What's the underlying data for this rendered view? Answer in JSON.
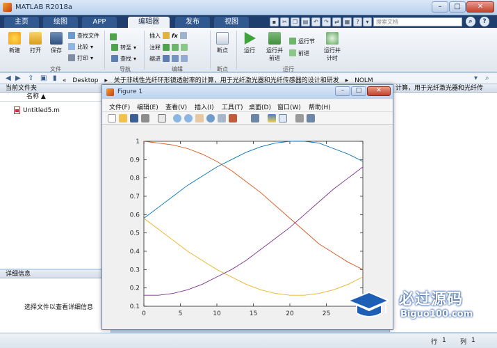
{
  "window": {
    "title": "MATLAB R2018a",
    "minimize": "–",
    "maximize": "□",
    "close": "✕"
  },
  "tabs": [
    {
      "label": "主页",
      "active": false
    },
    {
      "label": "绘图",
      "active": false
    },
    {
      "label": "APP",
      "active": false
    },
    {
      "label": "编辑器",
      "active": true
    },
    {
      "label": "发布",
      "active": false
    },
    {
      "label": "视图",
      "active": false
    }
  ],
  "quick_access": [
    "save-icon",
    "cut-icon",
    "copy-icon",
    "paste-icon",
    "undo-icon",
    "redo-icon",
    "switch-icon",
    "help-icon"
  ],
  "search": {
    "placeholder": "搜索文档"
  },
  "ribbon": {
    "file": {
      "new": "新建",
      "open": "打开",
      "save": "保存",
      "find_files": "查找文件",
      "compare": "比较",
      "print": "打印",
      "group": "文件"
    },
    "navigate": {
      "goto": "转至",
      "find": "查找",
      "group": "导航"
    },
    "edit": {
      "insert": "插入",
      "comment": "注释",
      "indent": "缩进",
      "fx": "fx",
      "group": "编辑"
    },
    "breakpoints": {
      "label": "断点",
      "group": "断点"
    },
    "run": {
      "run": "运行",
      "run_advance_1": "运行并",
      "run_advance_2": "前进",
      "run_section": "运行节",
      "advance": "前进",
      "run_time_1": "运行并",
      "run_time_2": "计时",
      "group": "运行"
    }
  },
  "address": {
    "segments": [
      "«",
      "Desktop",
      "▸",
      "关于非线性光纤环形镜透射率的计算，用于光纤激光器和光纤传感器的设计和研发",
      "▸",
      "NOLM"
    ],
    "overflow_text": "计算，用于光纤激光器和光纤传"
  },
  "current_folder": {
    "title": "当前文件夹",
    "column": "名称 ▲",
    "files": [
      "Untitled5.m"
    ]
  },
  "details": {
    "title": "详细信息",
    "empty_text": "选择文件以查看详细信息"
  },
  "status": {
    "row_label": "行",
    "row_value": "1",
    "col_label": "列",
    "col_value": "1"
  },
  "figure": {
    "title": "Figure 1",
    "menu": [
      "文件(F)",
      "编辑(E)",
      "查看(V)",
      "插入(I)",
      "工具(T)",
      "桌面(D)",
      "窗口(W)",
      "帮助(H)"
    ],
    "toolbar": [
      "new-figure-icon",
      "open-icon",
      "save-icon",
      "print-icon",
      "pointer-icon",
      "zoom-in-icon",
      "zoom-out-icon",
      "pan-icon",
      "rotate-icon",
      "data-cursor-icon",
      "brush-icon",
      "link-icon",
      "colorbar-icon",
      "legend-icon",
      "hide-tools-icon",
      "dock-icon"
    ]
  },
  "watermark": {
    "cn": "必过源码",
    "en": "Biguo100.com"
  },
  "chart_data": {
    "type": "line",
    "title": "",
    "xlabel": "",
    "ylabel": "",
    "xlim": [
      0,
      30
    ],
    "ylim": [
      0.1,
      1.0
    ],
    "xticks": [
      0,
      5,
      10,
      15,
      20,
      25,
      30
    ],
    "yticks": [
      0.1,
      0.2,
      0.3,
      0.4,
      0.5,
      0.6,
      0.7,
      0.8,
      0.9,
      1.0
    ],
    "tick_labels_x": [
      "0",
      "5",
      "10",
      "15",
      "20",
      "25",
      "30"
    ],
    "tick_labels_y": [
      "0.1",
      "0.2",
      "0.3",
      "0.4",
      "0.5",
      "0.6",
      "0.7",
      "0.8",
      "0.9",
      "1"
    ],
    "grid": false,
    "x": [
      0,
      2,
      4,
      6,
      8,
      10,
      12,
      14,
      16,
      18,
      20,
      22,
      24,
      26,
      28,
      30
    ],
    "series": [
      {
        "color": "#0072BD",
        "values": [
          0.58,
          0.64,
          0.7,
          0.76,
          0.81,
          0.86,
          0.9,
          0.94,
          0.97,
          0.99,
          1.0,
          1.0,
          0.99,
          0.96,
          0.93,
          0.89
        ]
      },
      {
        "color": "#D95319",
        "values": [
          1.0,
          0.99,
          0.98,
          0.96,
          0.93,
          0.89,
          0.84,
          0.78,
          0.72,
          0.65,
          0.58,
          0.51,
          0.44,
          0.39,
          0.34,
          0.3
        ]
      },
      {
        "color": "#EDB120",
        "values": [
          0.58,
          0.52,
          0.46,
          0.4,
          0.35,
          0.3,
          0.26,
          0.22,
          0.19,
          0.17,
          0.16,
          0.16,
          0.17,
          0.19,
          0.22,
          0.26
        ]
      },
      {
        "color": "#7E2F8E",
        "values": [
          0.16,
          0.16,
          0.17,
          0.19,
          0.22,
          0.26,
          0.3,
          0.35,
          0.41,
          0.47,
          0.53,
          0.6,
          0.67,
          0.74,
          0.8,
          0.86
        ]
      }
    ]
  }
}
